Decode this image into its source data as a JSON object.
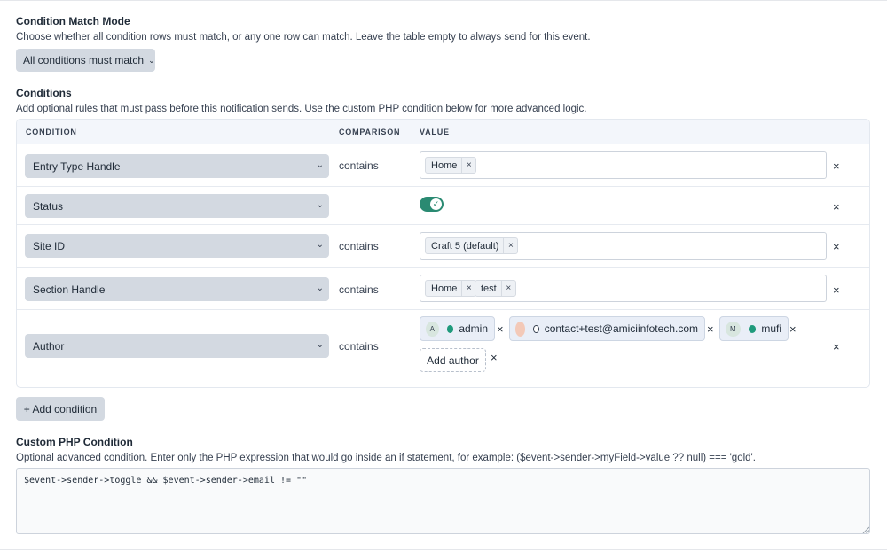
{
  "match_mode": {
    "heading": "Condition Match Mode",
    "description": "Choose whether all condition rows must match, or any one row can match. Leave the table empty to always send for this event.",
    "selected": "All conditions must match"
  },
  "conditions": {
    "heading": "Conditions",
    "description": "Add optional rules that must pass before this notification sends. Use the custom PHP condition below for more advanced logic.",
    "columns": {
      "condition": "CONDITION",
      "comparison": "COMPARISON",
      "value": "VALUE"
    },
    "rows": [
      {
        "field": "Entry Type Handle",
        "comparison": "contains",
        "tags": [
          "Home"
        ]
      },
      {
        "field": "Status",
        "comparison": "",
        "toggle": true
      },
      {
        "field": "Site ID",
        "comparison": "contains",
        "tags": [
          "Craft 5 (default)"
        ]
      },
      {
        "field": "Section Handle",
        "comparison": "contains",
        "tags": [
          "Home",
          "test"
        ]
      },
      {
        "field": "Author",
        "comparison": "contains",
        "authors": [
          {
            "initial": "A",
            "name": "admin",
            "status": "active"
          },
          {
            "initial": "",
            "name": "contact+test@amiciinfotech.com",
            "status": "inactive"
          },
          {
            "initial": "M",
            "name": "mufi",
            "status": "active"
          }
        ],
        "add_label": "Add author"
      }
    ],
    "add_button": "+ Add condition",
    "remove_symbol": "×"
  },
  "custom_php": {
    "heading": "Custom PHP Condition",
    "description": "Optional advanced condition. Enter only the PHP expression that would go inside an if statement, for example: ($event->sender->myField->value ?? null) === 'gold'.",
    "value": "$event->sender->toggle && $event->sender->email != \"\""
  },
  "colors": {
    "toggle_on": "#2a8a72",
    "status_active": "#1f9a7c",
    "button_bg": "#d3d9e1"
  },
  "icons": {
    "dropdown": "chevron-down-icon",
    "remove": "close-icon",
    "toggle_check": "check-icon"
  }
}
